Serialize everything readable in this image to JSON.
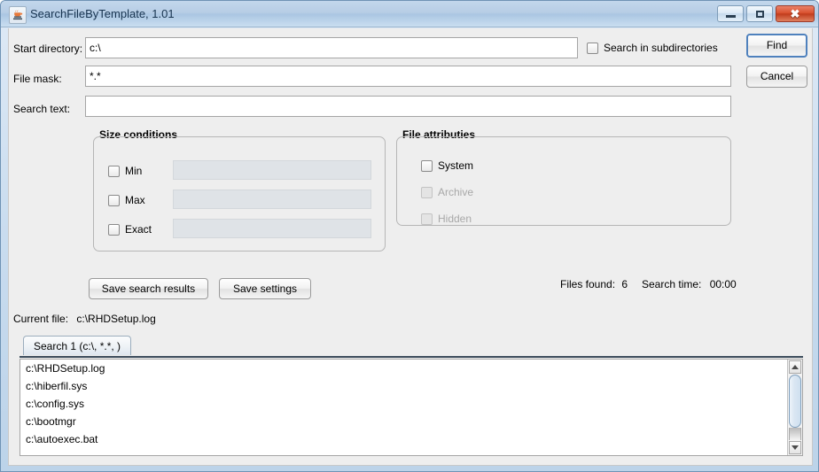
{
  "window": {
    "title": "SearchFileByTemplate, 1.01",
    "icon": "java-coffee-cup-icon",
    "controls": {
      "minimize": "minimize-icon",
      "maximize": "maximize-icon",
      "close": "✖"
    }
  },
  "form": {
    "start_directory_label": "Start directory:",
    "start_directory_value": "c:\\",
    "file_mask_label": "File mask:",
    "file_mask_value": "*.*",
    "search_text_label": "Search text:",
    "search_text_value": "",
    "search_subdirectories_label": "Search in subdirectories",
    "search_subdirectories_checked": false
  },
  "actions": {
    "find_label": "Find",
    "cancel_label": "Cancel",
    "save_results_label": "Save search results",
    "save_settings_label": "Save settings"
  },
  "size_conditions": {
    "title": "Size conditions",
    "rows": [
      {
        "label": "Min",
        "checked": false,
        "value": "",
        "enabled": false
      },
      {
        "label": "Max",
        "checked": false,
        "value": "",
        "enabled": false
      },
      {
        "label": "Exact",
        "checked": false,
        "value": "",
        "enabled": false
      }
    ]
  },
  "file_attributes": {
    "title": "File attributies",
    "rows": [
      {
        "label": "System",
        "checked": false,
        "enabled": true
      },
      {
        "label": "Archive",
        "checked": false,
        "enabled": false
      },
      {
        "label": "Hidden",
        "checked": false,
        "enabled": false
      }
    ]
  },
  "status": {
    "files_found_label": "Files found:",
    "files_found_value": "6",
    "search_time_label": "Search time:",
    "search_time_value": "00:00",
    "current_file_label": "Current file:",
    "current_file_value": "c:\\RHDSetup.log"
  },
  "results": {
    "tab_label": "Search 1 (c:\\, *.*, )",
    "items": [
      "c:\\RHDSetup.log",
      "c:\\hiberfil.sys",
      "c:\\config.sys",
      "c:\\bootmgr",
      "c:\\autoexec.bat"
    ]
  },
  "colors": {
    "background": "#eeeeee",
    "frame": "#bcd3e9",
    "focus": "#4f81bd",
    "close": "#d9522f"
  }
}
